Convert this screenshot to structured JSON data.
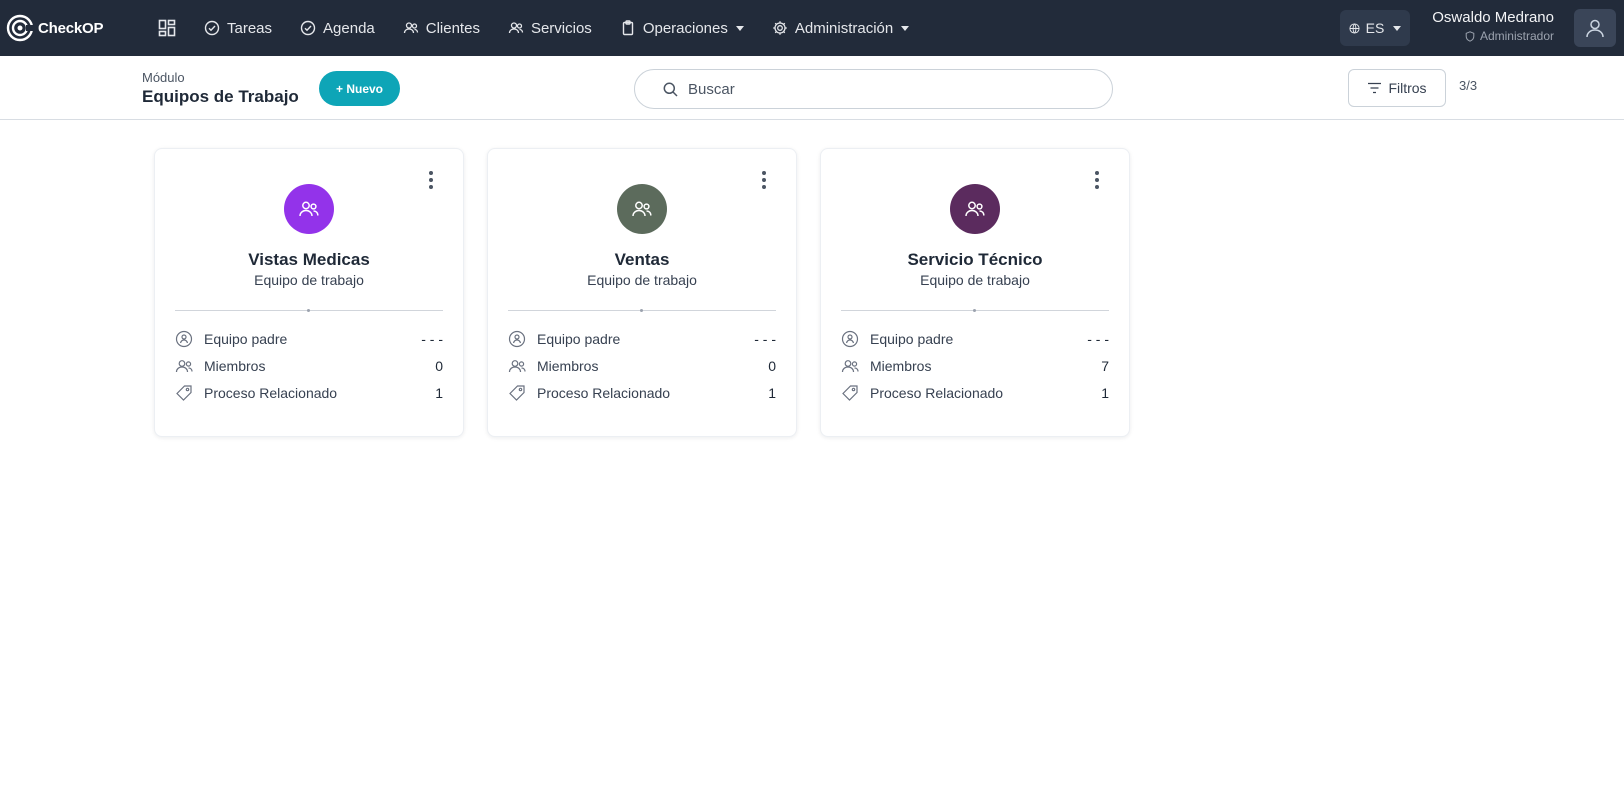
{
  "app": {
    "logo_text": "CheckOP"
  },
  "nav": {
    "items": [
      {
        "label": "Tareas"
      },
      {
        "label": "Agenda"
      },
      {
        "label": "Clientes"
      },
      {
        "label": "Servicios"
      },
      {
        "label": "Operaciones"
      },
      {
        "label": "Administración"
      }
    ],
    "language": "ES",
    "user": {
      "name": "Oswaldo Medrano",
      "role": "Administrador"
    }
  },
  "header": {
    "module_label": "Módulo",
    "module_title": "Equipos de Trabajo",
    "new_button": "+ Nuevo",
    "search_placeholder": "Buscar",
    "filters_button": "Filtros",
    "count": "3/3"
  },
  "row_labels": {
    "parent": "Equipo padre",
    "members": "Miembros",
    "process": "Proceso Relacionado"
  },
  "cards": [
    {
      "name": "Vistas Medicas",
      "type": "Equipo de trabajo",
      "color": "#9333ea",
      "parent": "- - -",
      "members": "0",
      "process": "1"
    },
    {
      "name": "Ventas",
      "type": "Equipo de trabajo",
      "color": "#5c6b5c",
      "parent": "- - -",
      "members": "0",
      "process": "1"
    },
    {
      "name": "Servicio Técnico",
      "type": "Equipo de trabajo",
      "color": "#5b2b5e",
      "parent": "- - -",
      "members": "7",
      "process": "1"
    }
  ]
}
